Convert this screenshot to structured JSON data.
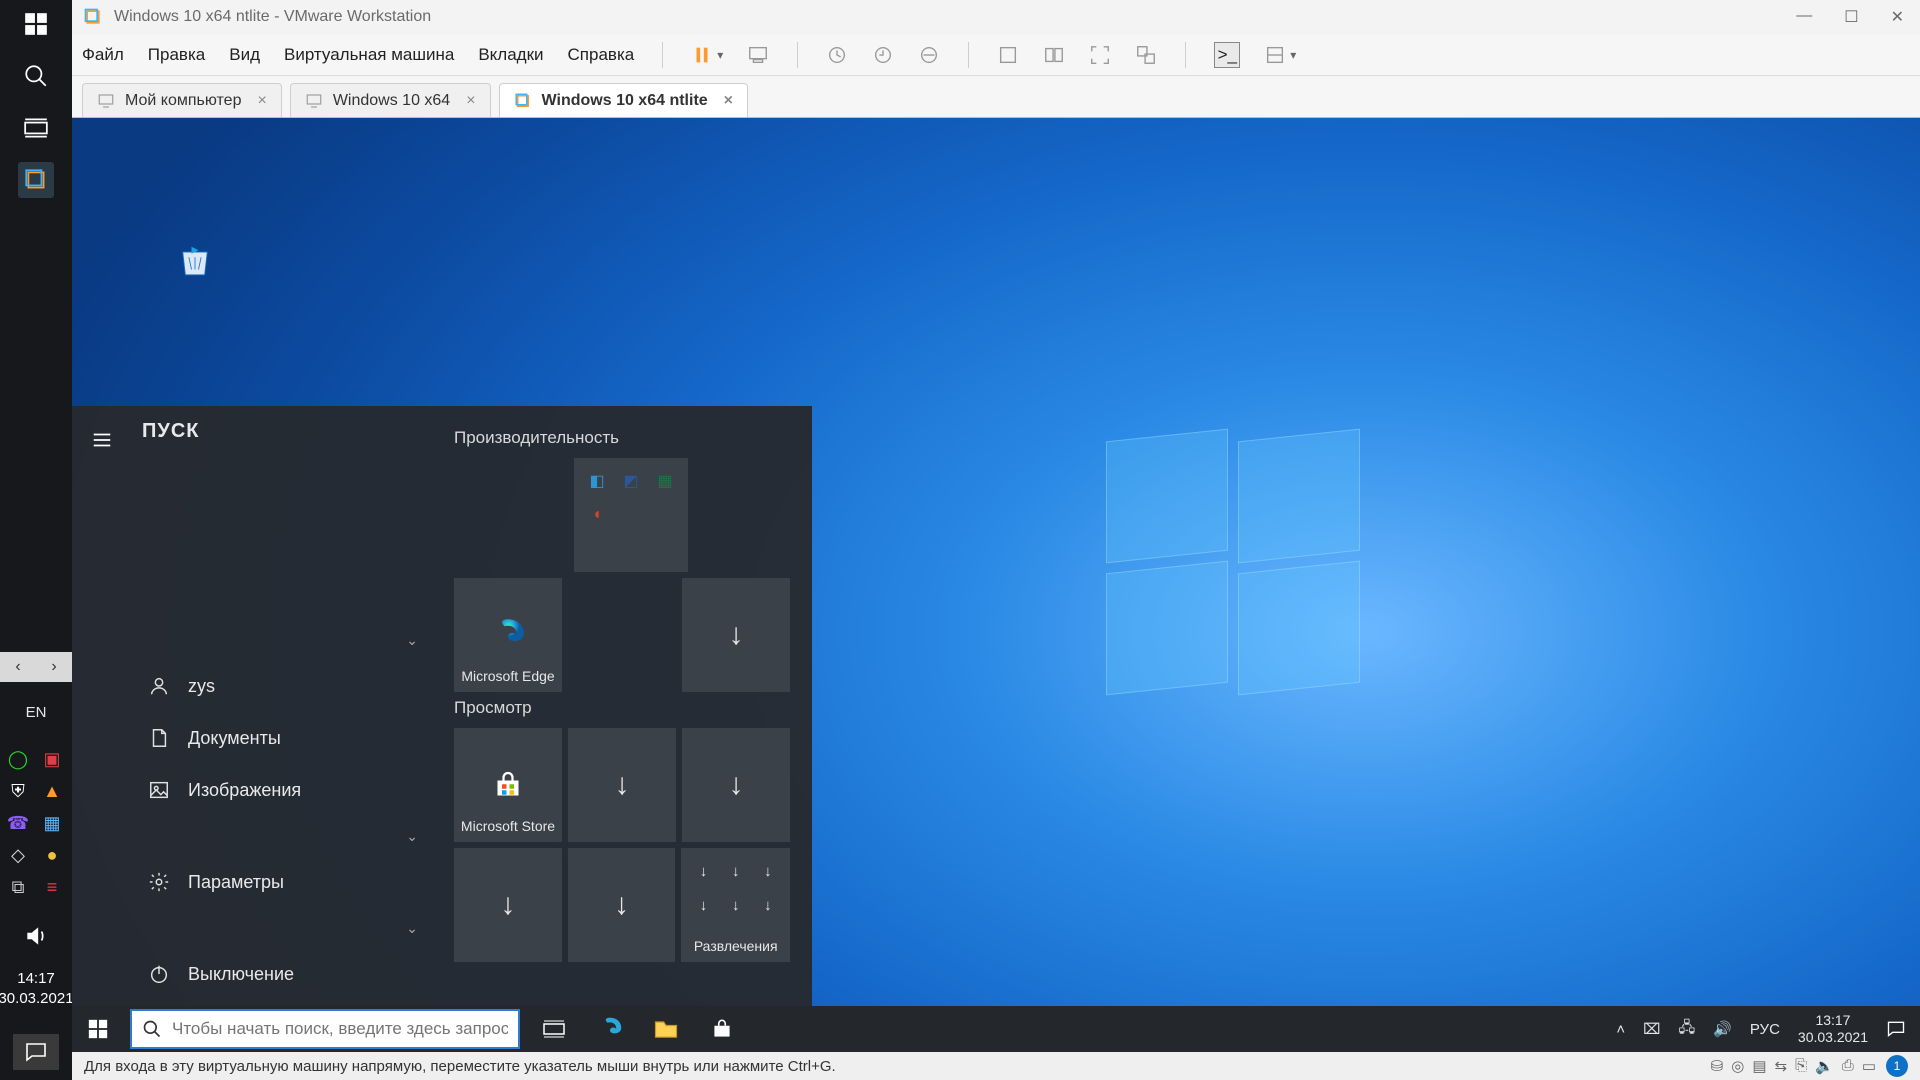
{
  "host": {
    "lang": "EN",
    "time": "14:17",
    "date": "30.03.2021",
    "nav": {
      "back": "‹",
      "fwd": "›"
    }
  },
  "vmware": {
    "title": "Windows 10 x64 ntlite - VMware Workstation",
    "menus": [
      "Файл",
      "Правка",
      "Вид",
      "Виртуальная машина",
      "Вкладки",
      "Справка"
    ],
    "tabs": [
      {
        "label": "Мой компьютер",
        "active": false
      },
      {
        "label": "Windows 10 x64",
        "active": false
      },
      {
        "label": "Windows 10 x64 ntlite",
        "active": true
      }
    ],
    "status_hint": "Для входа в эту виртуальную машину напрямую, переместите указатель мыши внутрь или нажмите Ctrl+G.",
    "status_badge": "1"
  },
  "guest": {
    "start": {
      "header": "ПУСК",
      "user": "zys",
      "items": {
        "documents": "Документы",
        "pictures": "Изображения",
        "settings": "Параметры",
        "power": "Выключение"
      },
      "groups": {
        "productivity": "Производительность",
        "browse": "Просмотр",
        "entertainment": "Развлечения"
      },
      "tiles": {
        "edge": "Microsoft Edge",
        "store": "Microsoft Store"
      }
    },
    "taskbar": {
      "search_placeholder": "Чтобы начать поиск, введите здесь запрос",
      "lang": "РУС",
      "time": "13:17",
      "date": "30.03.2021"
    }
  }
}
